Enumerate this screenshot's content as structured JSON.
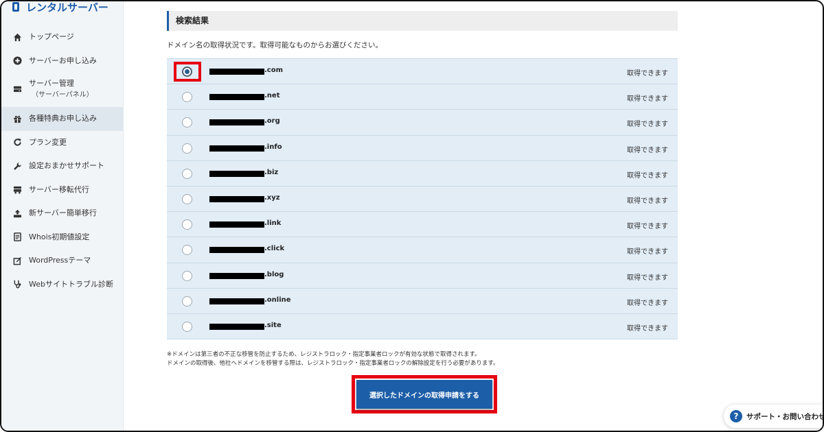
{
  "sidebar": {
    "brand": "レンタルサーバー",
    "items": [
      {
        "label": "トップページ",
        "icon": "home-icon"
      },
      {
        "label": "サーバーお申し込み",
        "icon": "plus-circle-icon"
      },
      {
        "label": "サーバー管理",
        "sub": "（サーバーパネル）",
        "icon": "server-icon"
      },
      {
        "label": "各種特典お申し込み",
        "icon": "gift-icon",
        "active": true
      },
      {
        "label": "プラン変更",
        "icon": "refresh-icon"
      },
      {
        "label": "設定おまかせサポート",
        "icon": "wrench-icon"
      },
      {
        "label": "サーバー移転代行",
        "icon": "truck-icon"
      },
      {
        "label": "新サーバー簡単移行",
        "icon": "upload-icon"
      },
      {
        "label": "Whois初期値設定",
        "icon": "document-icon"
      },
      {
        "label": "WordPressテーマ",
        "icon": "edit-icon"
      },
      {
        "label": "Webサイトトラブル診断",
        "icon": "stethoscope-icon"
      }
    ]
  },
  "main": {
    "section_title": "検索結果",
    "description": "ドメイン名の取得状況です。取得可能なものからお選びください。",
    "results": [
      {
        "tld": ".com",
        "status": "取得できます",
        "selected": true
      },
      {
        "tld": ".net",
        "status": "取得できます",
        "selected": false
      },
      {
        "tld": ".org",
        "status": "取得できます",
        "selected": false
      },
      {
        "tld": ".info",
        "status": "取得できます",
        "selected": false
      },
      {
        "tld": ".biz",
        "status": "取得できます",
        "selected": false
      },
      {
        "tld": ".xyz",
        "status": "取得できます",
        "selected": false
      },
      {
        "tld": ".link",
        "status": "取得できます",
        "selected": false
      },
      {
        "tld": ".click",
        "status": "取得できます",
        "selected": false
      },
      {
        "tld": ".blog",
        "status": "取得できます",
        "selected": false
      },
      {
        "tld": ".online",
        "status": "取得できます",
        "selected": false
      },
      {
        "tld": ".site",
        "status": "取得できます",
        "selected": false
      }
    ],
    "notes": [
      "※ドメインは第三者の不正な移管を防止するため、レジストラロック・指定事業者ロックが有効な状態で取得されます。",
      "ドメインの取得後、他社へドメインを移管する際は、レジストラロック・指定事業者ロックの解除設定を行う必要があります。"
    ],
    "submit_label": "選択したドメインの取得申請をする"
  },
  "support": {
    "label": "サポート・お問い合わせ",
    "icon": "question-icon"
  },
  "colors": {
    "accent": "#1d5ea8",
    "highlight": "#e60012",
    "row_bg": "#e2edf6"
  }
}
